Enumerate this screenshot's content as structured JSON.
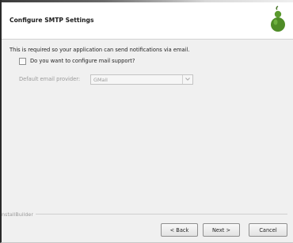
{
  "header": {
    "title": "Configure SMTP Settings",
    "logo_icon": "gourd-logo-icon",
    "logo_color": "#5b9a2e"
  },
  "content": {
    "intro": "This is required so your application can send notifications via email.",
    "mail_support": {
      "label": "Do you want to configure mail support?",
      "checked": false
    },
    "provider": {
      "label": "Default email provider:",
      "value": "GMail",
      "enabled": false
    }
  },
  "footer": {
    "brand": "nstallBuilder",
    "back_label": "< Back",
    "next_label": "Next >",
    "cancel_label": "Cancel"
  }
}
